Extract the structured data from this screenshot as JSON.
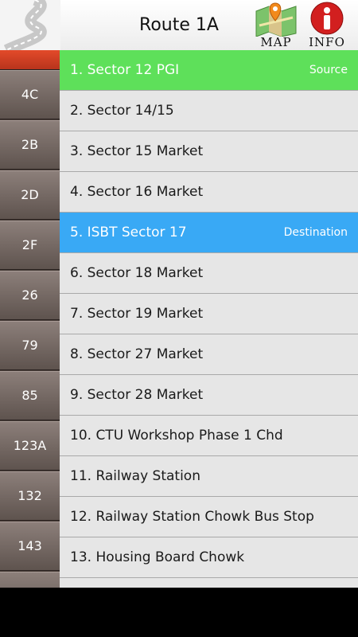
{
  "header": {
    "title": "Route 1A",
    "map_label": "MAP",
    "info_label": "INFO"
  },
  "sidebar": {
    "routes": [
      "4C",
      "2B",
      "2D",
      "2F",
      "26",
      "79",
      "85",
      "123A",
      "132",
      "143"
    ]
  },
  "stops": [
    {
      "label": "1. Sector 12 PGI",
      "tag": "Source"
    },
    {
      "label": "2. Sector 14/15",
      "tag": ""
    },
    {
      "label": "3. Sector 15 Market",
      "tag": ""
    },
    {
      "label": "4. Sector 16 Market",
      "tag": ""
    },
    {
      "label": "5. ISBT Sector 17",
      "tag": "Destination"
    },
    {
      "label": "6. Sector 18 Market",
      "tag": ""
    },
    {
      "label": "7. Sector 19 Market",
      "tag": ""
    },
    {
      "label": "8. Sector 27 Market",
      "tag": ""
    },
    {
      "label": "9. Sector 28 Market",
      "tag": ""
    },
    {
      "label": "10. CTU Workshop Phase 1 Chd",
      "tag": ""
    },
    {
      "label": "11. Railway Station",
      "tag": ""
    },
    {
      "label": "12. Railway Station Chowk Bus Stop",
      "tag": ""
    },
    {
      "label": "13. Housing Board Chowk",
      "tag": ""
    }
  ],
  "colors": {
    "source": "#5ee05a",
    "destination": "#39a9f5",
    "sidebar_active": "#e34a2a"
  },
  "icons": {
    "logo": "road-logo-icon",
    "map": "map-pin-icon",
    "info": "info-icon"
  }
}
